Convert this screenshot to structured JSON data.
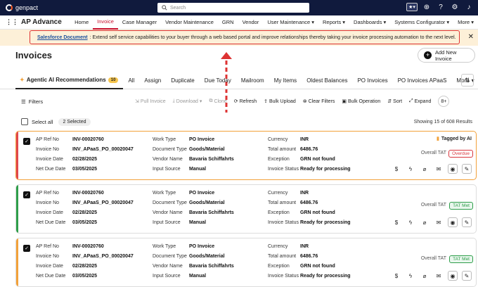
{
  "topbar": {
    "logo_text": "genpact",
    "search_placeholder": "Search",
    "icons": [
      "star-icon",
      "add-icon",
      "help-icon",
      "settings-icon",
      "bell-icon"
    ]
  },
  "nav": {
    "brand": "AP Advance",
    "items": [
      "Home",
      "Invoice",
      "Case Manager",
      "Vendor Maintenance",
      "GRN",
      "Vendor",
      "User Maintenance",
      "Reports",
      "Dashboards",
      "Systems Configurator",
      "More"
    ]
  },
  "banner": {
    "link_text": "Salesforce Document",
    "message": ": Extend self service capabilities to your buyer through a web based portal and improve relationships thereby taking your invoice processing automation to the next level."
  },
  "page": {
    "title": "Invoices",
    "new_button": "Add New Invoice"
  },
  "tabs": [
    {
      "label": "Agentic AI Recommendations",
      "badge": "10"
    },
    {
      "label": "All"
    },
    {
      "label": "Assign"
    },
    {
      "label": "Duplicate"
    },
    {
      "label": "Due Today"
    },
    {
      "label": "Mailroom"
    },
    {
      "label": "My Items"
    },
    {
      "label": "Oldest Balances"
    },
    {
      "label": "PO Invoices"
    },
    {
      "label": "PO Invoices APaaS"
    },
    {
      "label": "More"
    }
  ],
  "toolbar": {
    "filters": "Filters",
    "pull_invoice": "Pull Invoice",
    "download": "Download",
    "clone": "Clone",
    "refresh": "Refresh",
    "bulk_upload": "Bulk Upload",
    "clear_filters": "Clear Filters",
    "bulk_operation": "Bulk Operation",
    "sort": "Sort",
    "expand": "Expand",
    "more": "8+"
  },
  "selection": {
    "select_all": "Select all",
    "selected": "2 Selected",
    "results": "Showing 15 of 608 Results"
  },
  "labels": {
    "ap_ref_no": "AP Ref No",
    "invoice_no": "Invoice No",
    "invoice_date": "Invoice Date",
    "net_due_date": "Net Due Date",
    "work_type": "Work Type",
    "document_type": "Document Type",
    "vendor_name": "Vendor Name",
    "input_source": "Input Source",
    "currency": "Currency",
    "total_amount": "Total amount",
    "exception": "Exception",
    "invoice_status": "Invoice Status",
    "overall_tat": "Overall TAT"
  },
  "cards": [
    {
      "ap_ref_no": "INV-00020760",
      "invoice_no": "INV_APaaS_PO_00020047",
      "invoice_date": "02/28/2025",
      "net_due_date": "03/05/2025",
      "work_type": "PO Invoice",
      "document_type": "Goods/Material",
      "vendor_name": "Bavaria Schiffahrts",
      "input_source": "Manual",
      "currency": "INR",
      "total_amount": "6486.76",
      "exception": "GRN not found",
      "invoice_status": "Ready for processing",
      "tat": "Overdue",
      "tagged": "Tagged by AI",
      "checked": true,
      "bar_color": "#e0474c",
      "border_color": "#f2a13a"
    },
    {
      "ap_ref_no": "INV-00020760",
      "invoice_no": "INV_APaaS_PO_00020047",
      "invoice_date": "02/28/2025",
      "net_due_date": "03/05/2025",
      "work_type": "PO Invoice",
      "document_type": "Goods/Material",
      "vendor_name": "Bavaria Schiffahrts",
      "input_source": "Manual",
      "currency": "INR",
      "total_amount": "6486.76",
      "exception": "GRN not found",
      "invoice_status": "Ready for processing",
      "tat": "TAT Met",
      "checked": true,
      "bar_color": "#2e9e4a",
      "border_color": "#dddddd"
    },
    {
      "ap_ref_no": "INV-00020760",
      "invoice_no": "INV_APaaS_PO_00020047",
      "invoice_date": "02/28/2025",
      "net_due_date": "03/05/2025",
      "work_type": "PO Invoice",
      "document_type": "Goods/Material",
      "vendor_name": "Bavaria Schiffahrts",
      "input_source": "Manual",
      "currency": "INR",
      "total_amount": "6486.76",
      "exception": "GRN not found",
      "invoice_status": "Ready for processing",
      "tat": "TAT Met",
      "checked": true,
      "bar_color": "#f2a13a",
      "border_color": "#dddddd"
    }
  ],
  "colors": {
    "topbar": "#101a3d",
    "active_nav": "#c8102e",
    "banner_bg": "#fdf0d8",
    "annotation": "#dd3333",
    "overdue": "#d9363e",
    "tat_met": "#2e9e4a"
  }
}
